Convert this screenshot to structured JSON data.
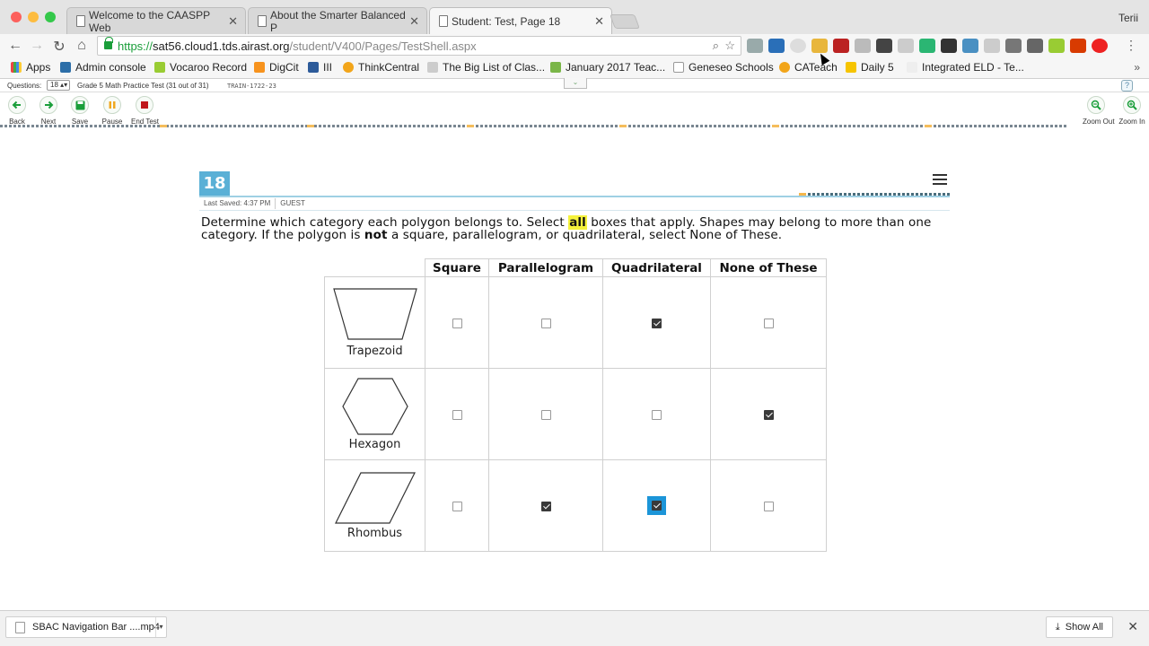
{
  "browser": {
    "tabs": [
      {
        "title": "Welcome to the CAASPP Web"
      },
      {
        "title": "About the Smarter Balanced P"
      },
      {
        "title": "Student: Test, Page 18"
      }
    ],
    "user": "Terii",
    "url": {
      "scheme": "https://",
      "host": "sat56.cloud1.tds.airast.org",
      "path": "/student/V400/Pages/TestShell.aspx"
    },
    "bookmarks": [
      "Apps",
      "Admin console",
      "Vocaroo Record",
      "DigCit",
      "III",
      "ThinkCentral",
      "The Big List of Clas...",
      "January 2017 Teac...",
      "Geneseo Schools",
      "CATeach",
      "Daily 5",
      "Integrated ELD - Te..."
    ]
  },
  "test_header": {
    "questions_label": "Questions:",
    "question_select": "18",
    "test_name": "Grade 5 Math Practice Test (31 out of 31)",
    "test_code": "TRAIN-1722-23"
  },
  "nav": {
    "back": "Back",
    "next": "Next",
    "save": "Save",
    "pause": "Pause",
    "end_test": "End Test",
    "zoom_out": "Zoom Out",
    "zoom_in": "Zoom In"
  },
  "item": {
    "number": "18",
    "last_saved": "Last Saved: 4:37 PM",
    "user_role": "GUEST",
    "stem_part1": "Determine which category each polygon belongs to. Select ",
    "stem_highlight": "all",
    "stem_part2": " boxes that apply. Shapes may belong to more than one category. If the polygon is ",
    "stem_bold": "not",
    "stem_part3": " a square, parallelogram, or quadrilateral, select None of These."
  },
  "grid": {
    "columns": [
      "Square",
      "Parallelogram",
      "Quadrilateral",
      "None of These"
    ],
    "rows": [
      {
        "shape": "Trapezoid",
        "checks": [
          false,
          false,
          true,
          false
        ]
      },
      {
        "shape": "Hexagon",
        "checks": [
          false,
          false,
          false,
          true
        ]
      },
      {
        "shape": "Rhombus",
        "checks": [
          false,
          true,
          true,
          false
        ]
      }
    ]
  },
  "downloads": {
    "file": "SBAC Navigation Bar ....mp4",
    "show_all": "Show All"
  }
}
